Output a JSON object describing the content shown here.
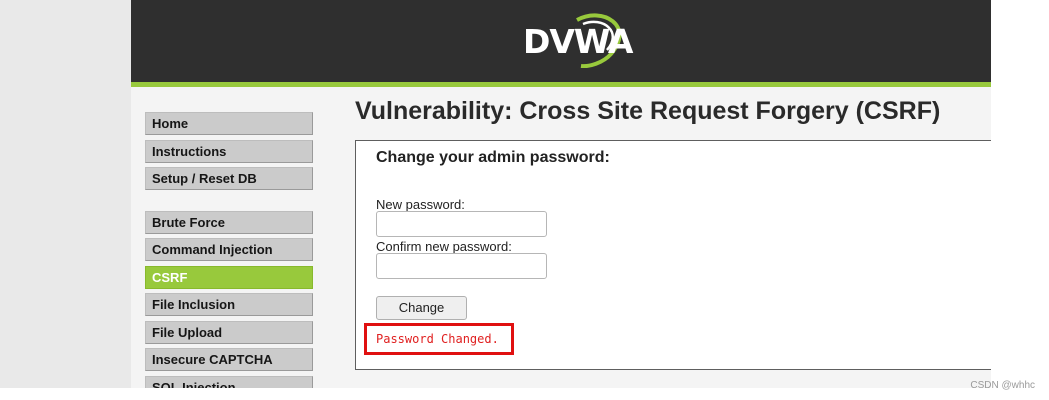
{
  "app": {
    "logo_text": "DVWA"
  },
  "sidebar": {
    "group1": [
      "Home",
      "Instructions",
      "Setup / Reset DB"
    ],
    "group2": [
      "Brute Force",
      "Command Injection",
      "CSRF",
      "File Inclusion",
      "File Upload",
      "Insecure CAPTCHA",
      "SQL Injection"
    ],
    "active": "CSRF"
  },
  "main": {
    "title": "Vulnerability: Cross Site Request Forgery (CSRF)",
    "form": {
      "heading": "Change your admin password:",
      "new_password_label": "New password:",
      "new_password_value": "",
      "confirm_password_label": "Confirm new password:",
      "confirm_password_value": "",
      "submit_label": "Change"
    },
    "message": "Password Changed."
  },
  "watermark": "CSDN @whhc",
  "colors": {
    "header_bg": "#2f2f2f",
    "accent_green": "#98c93c",
    "error_red": "#e01010"
  }
}
